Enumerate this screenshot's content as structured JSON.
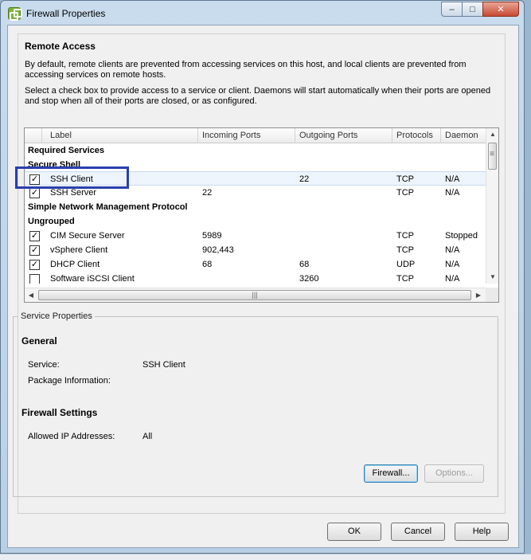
{
  "window": {
    "title": "Firewall Properties",
    "minimize_glyph": "–",
    "maximize_glyph": "□",
    "close_glyph": "✕"
  },
  "remote_access": {
    "heading": "Remote Access",
    "description1": "By default, remote clients are prevented from accessing services on this host, and local clients are prevented from accessing services on remote hosts.",
    "description2": "Select a check box to provide access to a service or client. Daemons will start automatically when their ports are opened and stop when all of their ports are closed, or as configured."
  },
  "table": {
    "columns": [
      "Label",
      "Incoming Ports",
      "Outgoing Ports",
      "Protocols",
      "Daemon"
    ],
    "rows": [
      {
        "type": "group",
        "label": "Required Services"
      },
      {
        "type": "group",
        "label": "Secure Shell"
      },
      {
        "type": "item",
        "checked": true,
        "label": "SSH Client",
        "incoming": "",
        "outgoing": "22",
        "protocol": "TCP",
        "daemon": "N/A",
        "selected": true
      },
      {
        "type": "item",
        "checked": true,
        "label": "SSH Server",
        "incoming": "22",
        "outgoing": "",
        "protocol": "TCP",
        "daemon": "N/A"
      },
      {
        "type": "group",
        "label": "Simple Network Management Protocol"
      },
      {
        "type": "group",
        "label": "Ungrouped"
      },
      {
        "type": "item",
        "checked": true,
        "label": "CIM Secure Server",
        "incoming": "5989",
        "outgoing": "",
        "protocol": "TCP",
        "daemon": "Stopped"
      },
      {
        "type": "item",
        "checked": true,
        "label": "vSphere Client",
        "incoming": "902,443",
        "outgoing": "",
        "protocol": "TCP",
        "daemon": "N/A"
      },
      {
        "type": "item",
        "checked": true,
        "label": "DHCP Client",
        "incoming": "68",
        "outgoing": "68",
        "protocol": "UDP",
        "daemon": "N/A"
      },
      {
        "type": "item",
        "checked": false,
        "label": "Software iSCSI Client",
        "incoming": "",
        "outgoing": "3260",
        "protocol": "TCP",
        "daemon": "N/A"
      }
    ]
  },
  "service_properties": {
    "legend": "Service Properties",
    "general_heading": "General",
    "service_label": "Service:",
    "service_value": "SSH Client",
    "package_label": "Package Information:",
    "package_value": "",
    "firewall_heading": "Firewall Settings",
    "allowed_ip_label": "Allowed IP Addresses:",
    "allowed_ip_value": "All",
    "firewall_button": "Firewall...",
    "options_button": "Options..."
  },
  "footer": {
    "ok": "OK",
    "cancel": "Cancel",
    "help": "Help"
  }
}
